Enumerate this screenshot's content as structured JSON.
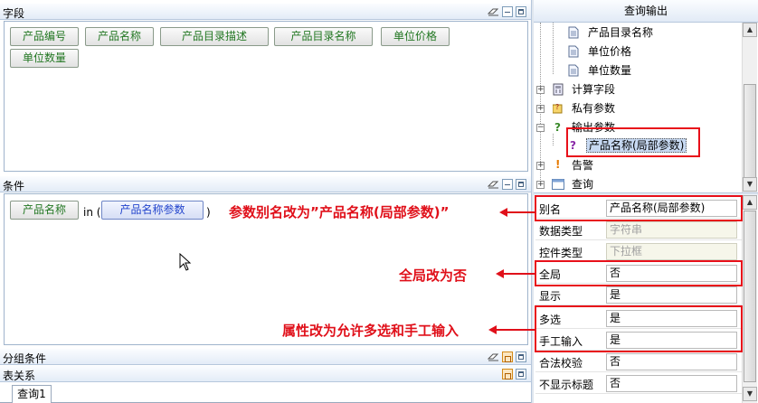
{
  "left": {
    "fields_title": "字段",
    "field_buttons": [
      "产品编号",
      "产品名称",
      "产品目录描述",
      "产品目录名称",
      "单位价格",
      "单位数量"
    ],
    "conditions_title": "条件",
    "condition": {
      "field": "产品名称",
      "op": "in (",
      "param": "产品名称参数",
      "close": ")"
    },
    "group_title": "分组条件",
    "relation_title": "表关系",
    "tab_label": "查询1"
  },
  "right": {
    "title": "查询输出",
    "tree": [
      {
        "label": "产品目录名称",
        "icon": "doc-icon"
      },
      {
        "label": "单位价格",
        "icon": "doc-icon"
      },
      {
        "label": "单位数量",
        "icon": "doc-icon"
      },
      {
        "label": "计算字段",
        "icon": "calc-icon"
      },
      {
        "label": "私有参数",
        "icon": "private-param-icon"
      },
      {
        "label": "输出参数",
        "icon": "question-icon"
      },
      {
        "label": "产品名称(局部参数)",
        "icon": "question-purple-icon"
      },
      {
        "label": "告警",
        "icon": "alert-icon"
      },
      {
        "label": "查询",
        "icon": "query-icon"
      }
    ],
    "properties": [
      {
        "label": "别名",
        "value": "产品名称(局部参数)",
        "disabled": false
      },
      {
        "label": "数据类型",
        "value": "字符串",
        "disabled": true
      },
      {
        "label": "控件类型",
        "value": "下拉框",
        "disabled": true
      },
      {
        "label": "全局",
        "value": "否",
        "disabled": false
      },
      {
        "label": "显示",
        "value": "是",
        "disabled": false
      },
      {
        "label": "多选",
        "value": "是",
        "disabled": false
      },
      {
        "label": "手工输入",
        "value": "是",
        "disabled": false
      },
      {
        "label": "合法校验",
        "value": "否",
        "disabled": false
      },
      {
        "label": "不显示标题",
        "value": "否",
        "disabled": false
      }
    ]
  },
  "annotations": {
    "alias": "参数别名改为”产品名称(局部参数)”",
    "global": "全局改为否",
    "multi": "属性改为允许多选和手工输入"
  },
  "colors": {
    "annotation": "#e0101a",
    "field_text": "#227722",
    "param_text": "#2244cc"
  }
}
